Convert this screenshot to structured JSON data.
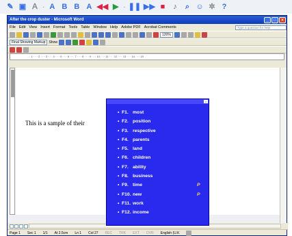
{
  "top_toolbar": {
    "icons": [
      "pencil-icon",
      "format-icon",
      "font-icon",
      "text-a-icon",
      "bold-icon",
      "bold-alt-icon",
      "text-a2-icon",
      "rewind-icon",
      "play-icon",
      "pause-icon",
      "fast-forward-icon",
      "stop-icon",
      "volume-icon",
      "search-icon",
      "users-icon",
      "settings-icon",
      "help-icon"
    ]
  },
  "window": {
    "title": "After the crop duster - Microsoft Word"
  },
  "menu": {
    "items": [
      "File",
      "Edit",
      "View",
      "Insert",
      "Format",
      "Tools",
      "Table",
      "Window",
      "Help",
      "Adobe PDF",
      "Acrobat Comments"
    ],
    "help_placeholder": "Type a question for help"
  },
  "standard_toolbar": {
    "zoom": "120%"
  },
  "review_toolbar": {
    "markup": "Final Showing Markup",
    "show": "Show"
  },
  "document": {
    "sample_text": "This is a sample of their"
  },
  "status_bar": {
    "page": "Page 1",
    "section": "Sec 1",
    "page_count": "1/1",
    "at": "At 2.5cm",
    "line": "Ln 1",
    "col": "Col 27",
    "rec": "REC",
    "trk": "TRK",
    "ext": "EXT",
    "ovr": "OVR",
    "language": "English (U.K"
  },
  "popup": {
    "items": [
      {
        "key": "F1.",
        "word": "most",
        "mark": ""
      },
      {
        "key": "F2.",
        "word": "position",
        "mark": ""
      },
      {
        "key": "F3.",
        "word": "respective",
        "mark": ""
      },
      {
        "key": "F4.",
        "word": "parents",
        "mark": ""
      },
      {
        "key": "F5.",
        "word": "land",
        "mark": ""
      },
      {
        "key": "F6.",
        "word": "children",
        "mark": ""
      },
      {
        "key": "F7.",
        "word": "ability",
        "mark": ""
      },
      {
        "key": "F8.",
        "word": "business",
        "mark": ""
      },
      {
        "key": "F9.",
        "word": "time",
        "mark": "P"
      },
      {
        "key": "F10.",
        "word": "new",
        "mark": "P"
      },
      {
        "key": "F11.",
        "word": "work",
        "mark": ""
      },
      {
        "key": "F12.",
        "word": "income",
        "mark": ""
      }
    ]
  },
  "colors": {
    "popup_bg": "#2a2aee",
    "title_bar": "#0d3cb8"
  }
}
